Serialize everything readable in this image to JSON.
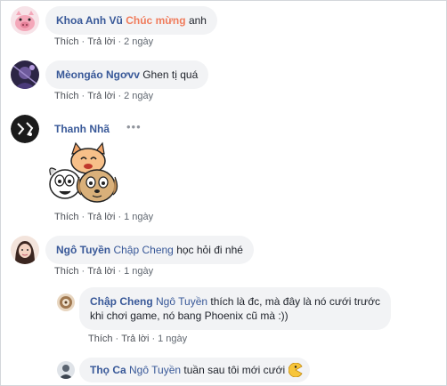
{
  "comments": [
    {
      "author": "Khoa Anh Vũ",
      "highlight": "Chúc mừng",
      "text": "anh",
      "actions": {
        "like": "Thích",
        "reply": "Trả lời",
        "time": "2 ngày"
      }
    },
    {
      "author": "Mèongáo Ngơvv",
      "text": "Ghen tị quá",
      "actions": {
        "like": "Thích",
        "reply": "Trả lời",
        "time": "2 ngày"
      }
    },
    {
      "author": "Thanh Nhã",
      "more": "•••",
      "sticker": "cartoon-cat-and-dog-sticker",
      "actions": {
        "like": "Thích",
        "reply": "Trả lời",
        "time": "1 ngày"
      }
    },
    {
      "author": "Ngô Tuyền",
      "mention": "Chập Cheng",
      "text": "học hỏi đi nhé",
      "actions": {
        "like": "Thích",
        "reply": "Trả lời",
        "time": "1 ngày"
      }
    }
  ],
  "replies": [
    {
      "author": "Chập Cheng",
      "mention": "Ngô Tuyền",
      "text_line1": "thích là đc, mà đây là nó cưới trước",
      "text_line2": "khi chơi game, nó bang Phoenix cũ mà :))",
      "actions": {
        "like": "Thích",
        "reply": "Trả lời",
        "time": "1 ngày"
      }
    },
    {
      "author": "Thọ Ca",
      "mention": "Ngô Tuyền",
      "text": "tuần sau tôi mới cưới",
      "emoji": "pacman-emoticon"
    }
  ],
  "colors": {
    "link": "#385898",
    "highlight": "#f07c5c",
    "bubble": "#f2f3f5",
    "meta": "#606770"
  }
}
